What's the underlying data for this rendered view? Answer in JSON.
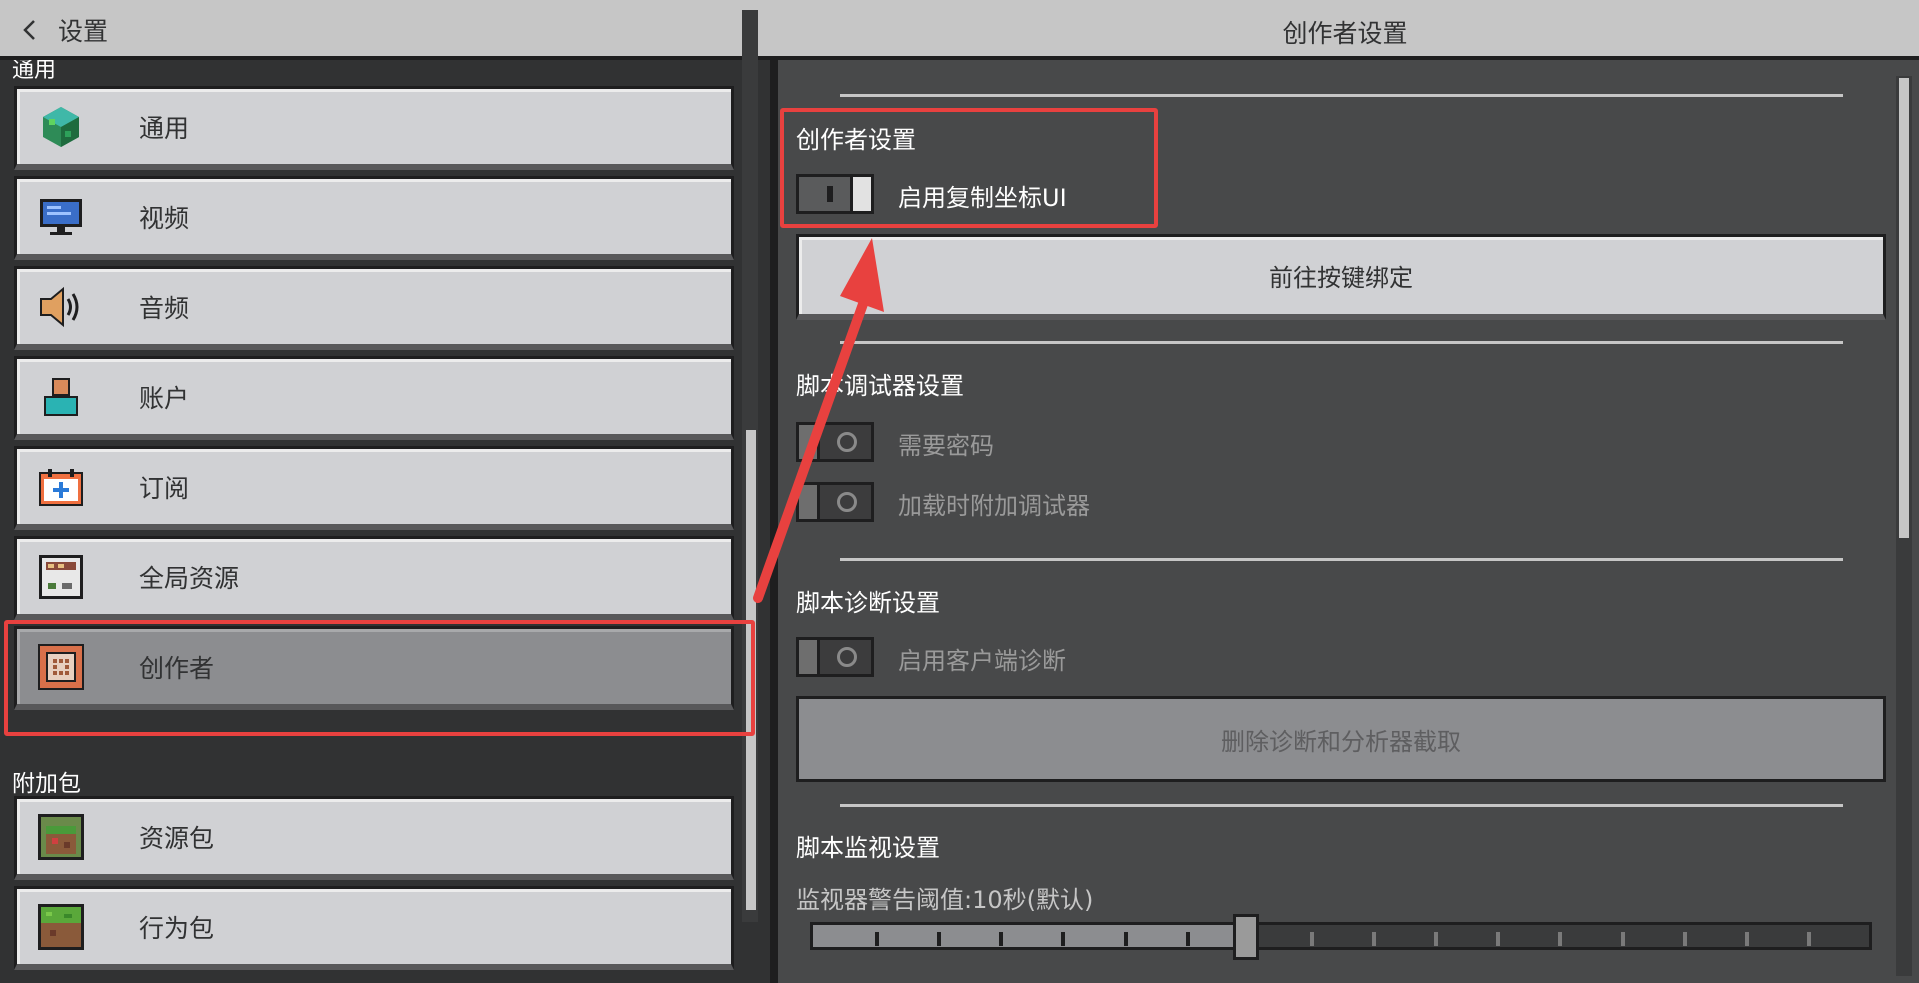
{
  "header": {
    "back_label": "设置",
    "title": "创作者设置"
  },
  "sidebar": {
    "section_general": "通用",
    "section_addons": "附加包",
    "items": [
      {
        "label": "通用",
        "icon": "grass-globe-icon"
      },
      {
        "label": "视频",
        "icon": "monitor-icon"
      },
      {
        "label": "音频",
        "icon": "speaker-icon"
      },
      {
        "label": "账户",
        "icon": "account-icon"
      },
      {
        "label": "订阅",
        "icon": "subscription-icon"
      },
      {
        "label": "全局资源",
        "icon": "global-resources-icon"
      },
      {
        "label": "创作者",
        "icon": "creator-icon",
        "active": true
      }
    ],
    "addon_items": [
      {
        "label": "资源包",
        "icon": "resource-pack-icon"
      },
      {
        "label": "行为包",
        "icon": "behavior-pack-icon"
      }
    ]
  },
  "content": {
    "creator": {
      "title": "创作者设置",
      "copy_coordinates_label": "启用复制坐标UI",
      "copy_coordinates_on": true,
      "keybind_button": "前往按键绑定"
    },
    "debugger": {
      "title": "脚本调试器设置",
      "require_password_label": "需要密码",
      "attach_on_load_label": "加载时附加调试器"
    },
    "diagnostics": {
      "title": "脚本诊断设置",
      "client_diagnostics_label": "启用客户端诊断",
      "delete_button": "删除诊断和分析器截取"
    },
    "watchdog": {
      "title": "脚本监视设置",
      "threshold_label": "监视器警告阈值:10秒(默认)",
      "slider_fraction": 0.41
    }
  },
  "colors": {
    "highlight": "#e8413f",
    "background": "#313233",
    "header": "#c6c6c6"
  }
}
